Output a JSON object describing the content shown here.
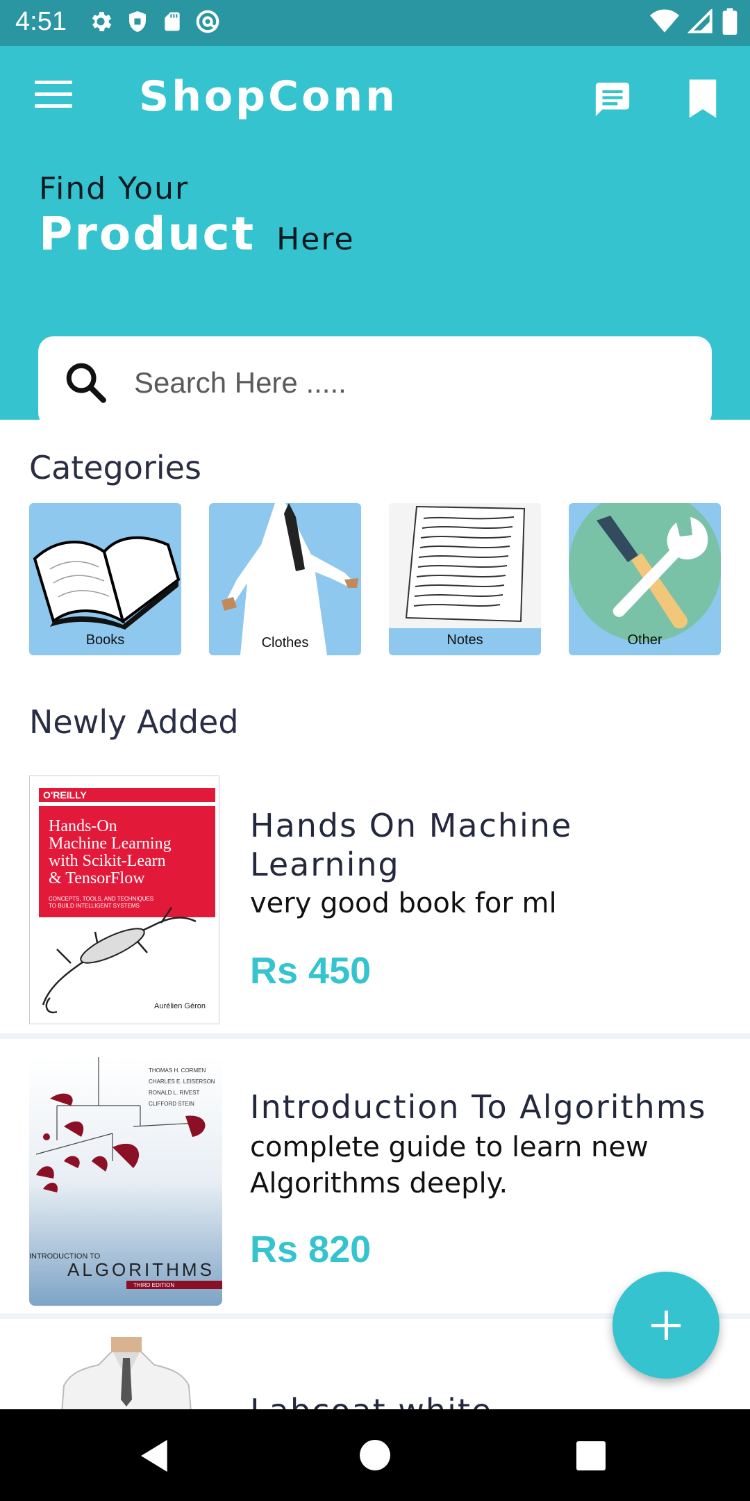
{
  "status_bar": {
    "time": "4:51",
    "left_icons": [
      "gear-icon",
      "shield-icon",
      "sd-card-icon",
      "at-sign-icon"
    ],
    "right_icons": [
      "wifi-icon",
      "signal-icon",
      "battery-icon"
    ]
  },
  "header": {
    "app_title": "ShopConn",
    "tagline_line1": "Find Your",
    "tagline_product": "Product",
    "tagline_here": "Here",
    "accent_color": "#34c3cf"
  },
  "search": {
    "placeholder": "Search Here ....."
  },
  "categories": {
    "title": "Categories",
    "items": [
      {
        "label": "Books"
      },
      {
        "label": "Clothes"
      },
      {
        "label": "Notes"
      },
      {
        "label": "Other"
      }
    ]
  },
  "newly_added": {
    "title": "Newly Added",
    "products": [
      {
        "name": "Hands On Machine Learning",
        "description": "very good book for ml",
        "price": "Rs 450",
        "cover_publisher": "O'REILLY",
        "cover_title": "Hands-On Machine Learning with Scikit-Learn & TensorFlow",
        "cover_subtitle": "CONCEPTS, TOOLS, AND TECHNIQUES TO BUILD INTELLIGENT SYSTEMS",
        "cover_author": "Aurélien Géron"
      },
      {
        "name": "Introduction To Algorithms",
        "description": "complete guide to learn new Algorithms deeply.",
        "price": "Rs 820",
        "cover_authors": [
          "THOMAS H. CORMEN",
          "CHARLES E. LEISERSON",
          "RONALD L. RIVEST",
          "CLIFFORD STEIN"
        ],
        "cover_intro": "INTRODUCTION TO",
        "cover_title": "ALGORITHMS",
        "cover_edition": "THIRD EDITION"
      },
      {
        "name": "Labcoat white"
      }
    ]
  },
  "fab": {
    "icon": "plus-icon"
  },
  "nav": {
    "icons": [
      "back-icon",
      "home-icon",
      "recents-icon"
    ]
  }
}
